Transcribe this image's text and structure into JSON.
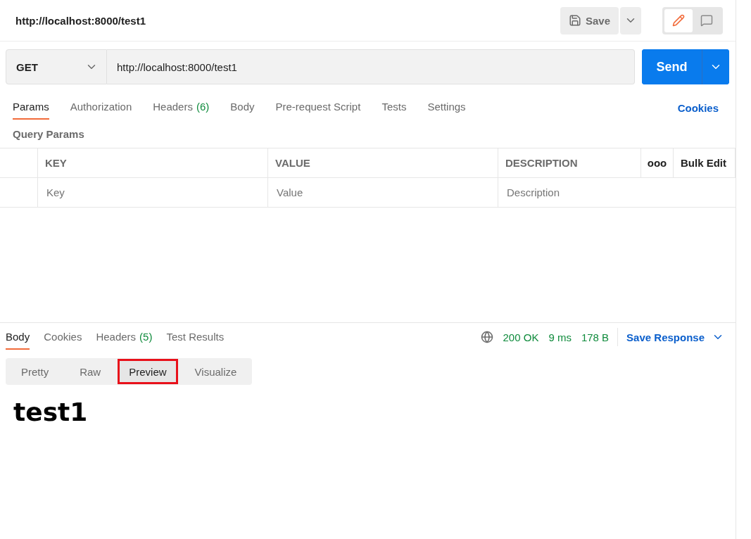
{
  "header": {
    "title": "http://localhost:8000/test1",
    "save_label": "Save",
    "mode_buttons": [
      {
        "kind": "edit",
        "selected": true
      },
      {
        "kind": "comment",
        "selected": false
      }
    ]
  },
  "request": {
    "method": "GET",
    "url": "http://localhost:8000/test1",
    "send_label": "Send"
  },
  "request_tabs": [
    {
      "label": "Params",
      "selected": true
    },
    {
      "label": "Authorization",
      "selected": false
    },
    {
      "label": "Headers",
      "count": "(6)",
      "selected": false
    },
    {
      "label": "Body",
      "selected": false
    },
    {
      "label": "Pre-request Script",
      "selected": false
    },
    {
      "label": "Tests",
      "selected": false
    },
    {
      "label": "Settings",
      "selected": false
    }
  ],
  "cookies_link": "Cookies",
  "query_params": {
    "title": "Query Params",
    "columns": [
      "KEY",
      "VALUE",
      "DESCRIPTION"
    ],
    "more": "ooo",
    "bulk_edit": "Bulk Edit",
    "placeholders": [
      "Key",
      "Value",
      "Description"
    ]
  },
  "response_tabs": [
    {
      "label": "Body",
      "selected": true
    },
    {
      "label": "Cookies",
      "selected": false
    },
    {
      "label": "Headers",
      "count": "(5)",
      "selected": false
    },
    {
      "label": "Test Results",
      "selected": false
    }
  ],
  "status": {
    "code": "200 OK",
    "time": "9 ms",
    "size": "178 B",
    "save_response": "Save Response"
  },
  "views": [
    {
      "label": "Pretty",
      "selected": false,
      "highlighted": false
    },
    {
      "label": "Raw",
      "selected": false,
      "highlighted": false
    },
    {
      "label": "Preview",
      "selected": true,
      "highlighted": true
    },
    {
      "label": "Visualize",
      "selected": false,
      "highlighted": false
    }
  ],
  "preview_heading": "test1"
}
